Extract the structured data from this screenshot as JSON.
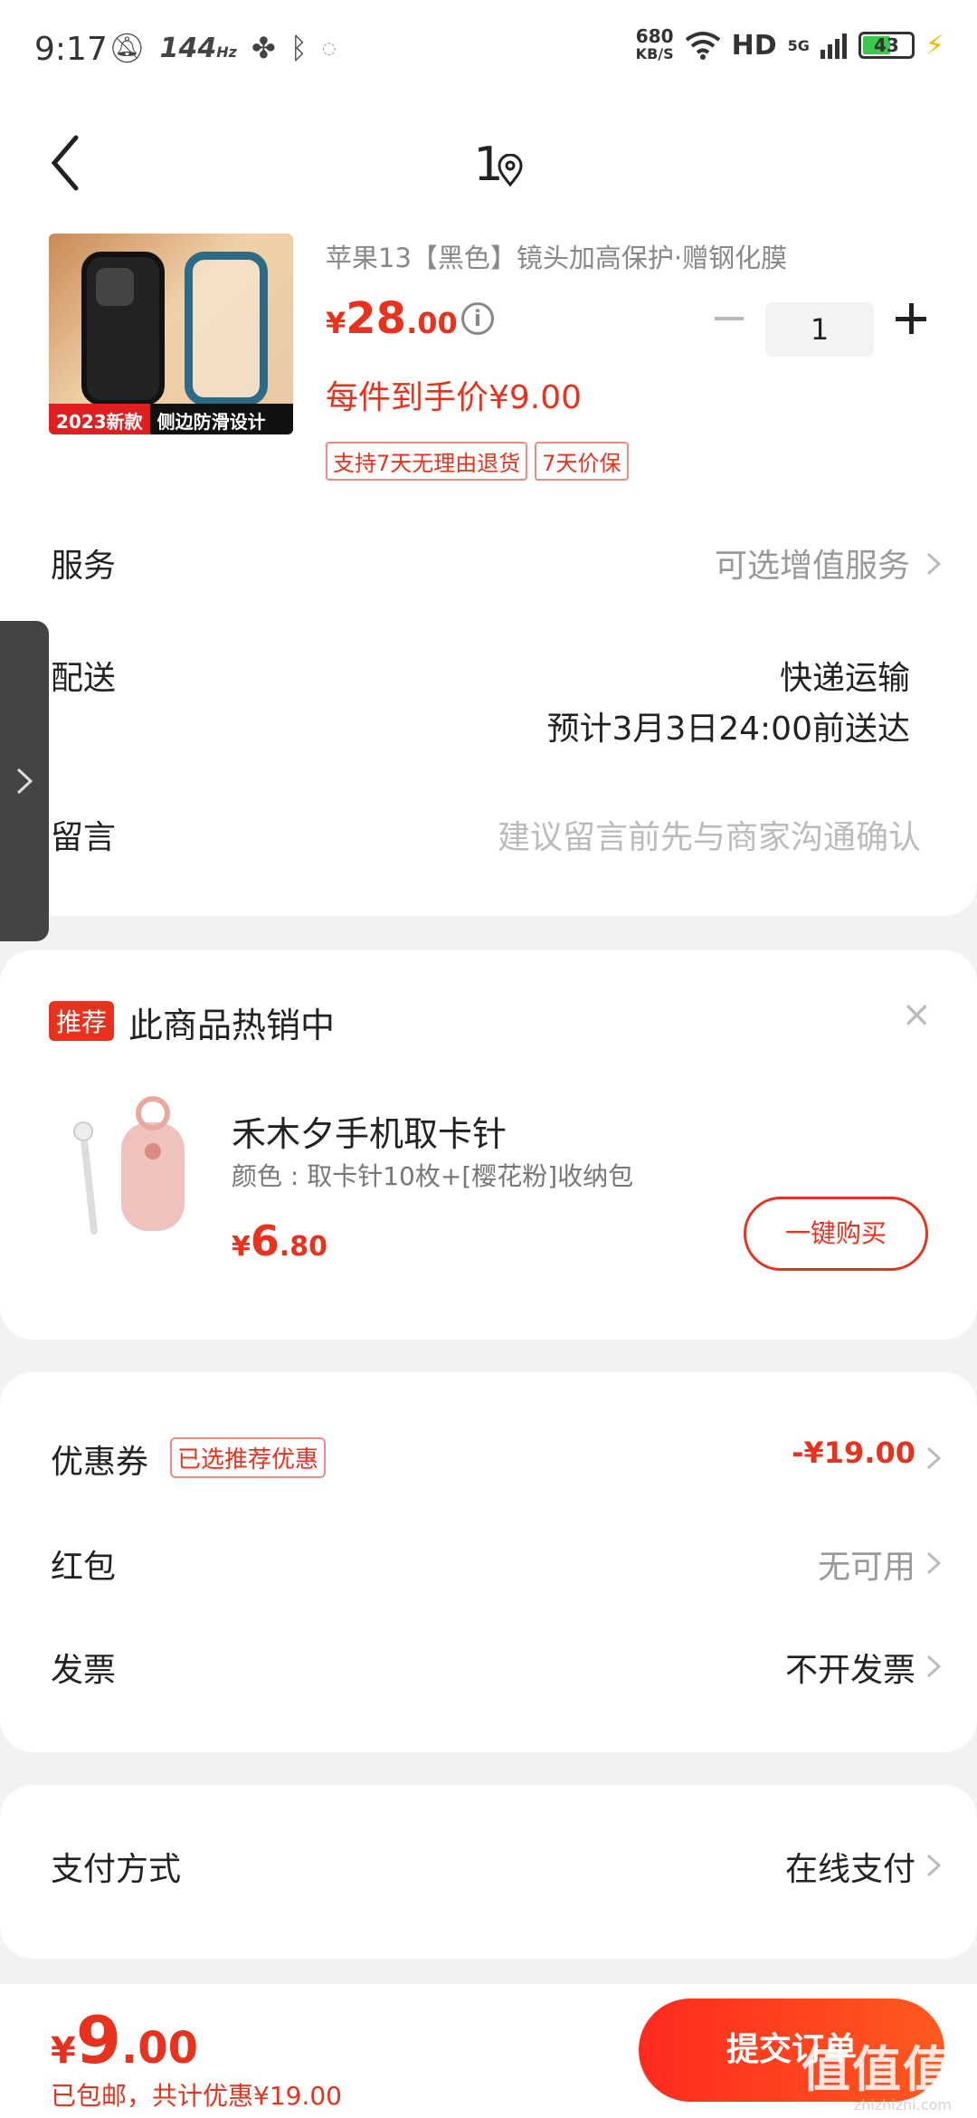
{
  "status_bar": {
    "time": "9:17",
    "refresh_rate": "144",
    "refresh_unit": "Hz",
    "net_speed_value": "680",
    "net_speed_unit": "KB/S",
    "hd": "HD",
    "network": "5G",
    "battery": "43"
  },
  "header": {
    "title": "1"
  },
  "product": {
    "title": "苹果13【黑色】镜头加高保护·赠钢化膜",
    "price_currency": "¥",
    "price_int": "28",
    "price_dec": ".00",
    "price_each": "每件到手价¥9.00",
    "quantity": "1",
    "image_tag_a": "2023新款",
    "image_tag_b": "侧边防滑设计",
    "badges": [
      "支持7天无理由退货",
      "7天价保"
    ]
  },
  "rows": {
    "service_label": "服务",
    "service_value": "可选增值服务",
    "delivery_label": "配送",
    "delivery_method": "快递运输",
    "delivery_eta": "预计3月3日24:00前送达",
    "message_label": "留言",
    "message_placeholder": "建议留言前先与商家沟通确认"
  },
  "recommend": {
    "tag": "推荐",
    "title": "此商品热销中",
    "close": "×",
    "item_name": "禾木夕手机取卡针",
    "item_spec": "颜色 : 取卡针10枚+[樱花粉]收纳包",
    "price_currency": "¥",
    "price_int": "6",
    "price_dec": ".80",
    "buy_label": "一键购买"
  },
  "discounts": {
    "coupon_label": "优惠券",
    "coupon_tag": "已选推荐优惠",
    "coupon_value": "-¥19.00",
    "redpacket_label": "红包",
    "redpacket_value": "无可用",
    "invoice_label": "发票",
    "invoice_value": "不开发票"
  },
  "payment": {
    "label": "支付方式",
    "value": "在线支付"
  },
  "bottom": {
    "currency": "¥",
    "total_int": "9",
    "total_dec": ".00",
    "note": "已包邮，共计优惠¥19.00",
    "submit_label": "提交订单",
    "watermark": "值值值",
    "watermark_sub": "zhizhizhi.com"
  },
  "colors": {
    "accent": "#e8321e",
    "background": "#f2f2f2"
  }
}
